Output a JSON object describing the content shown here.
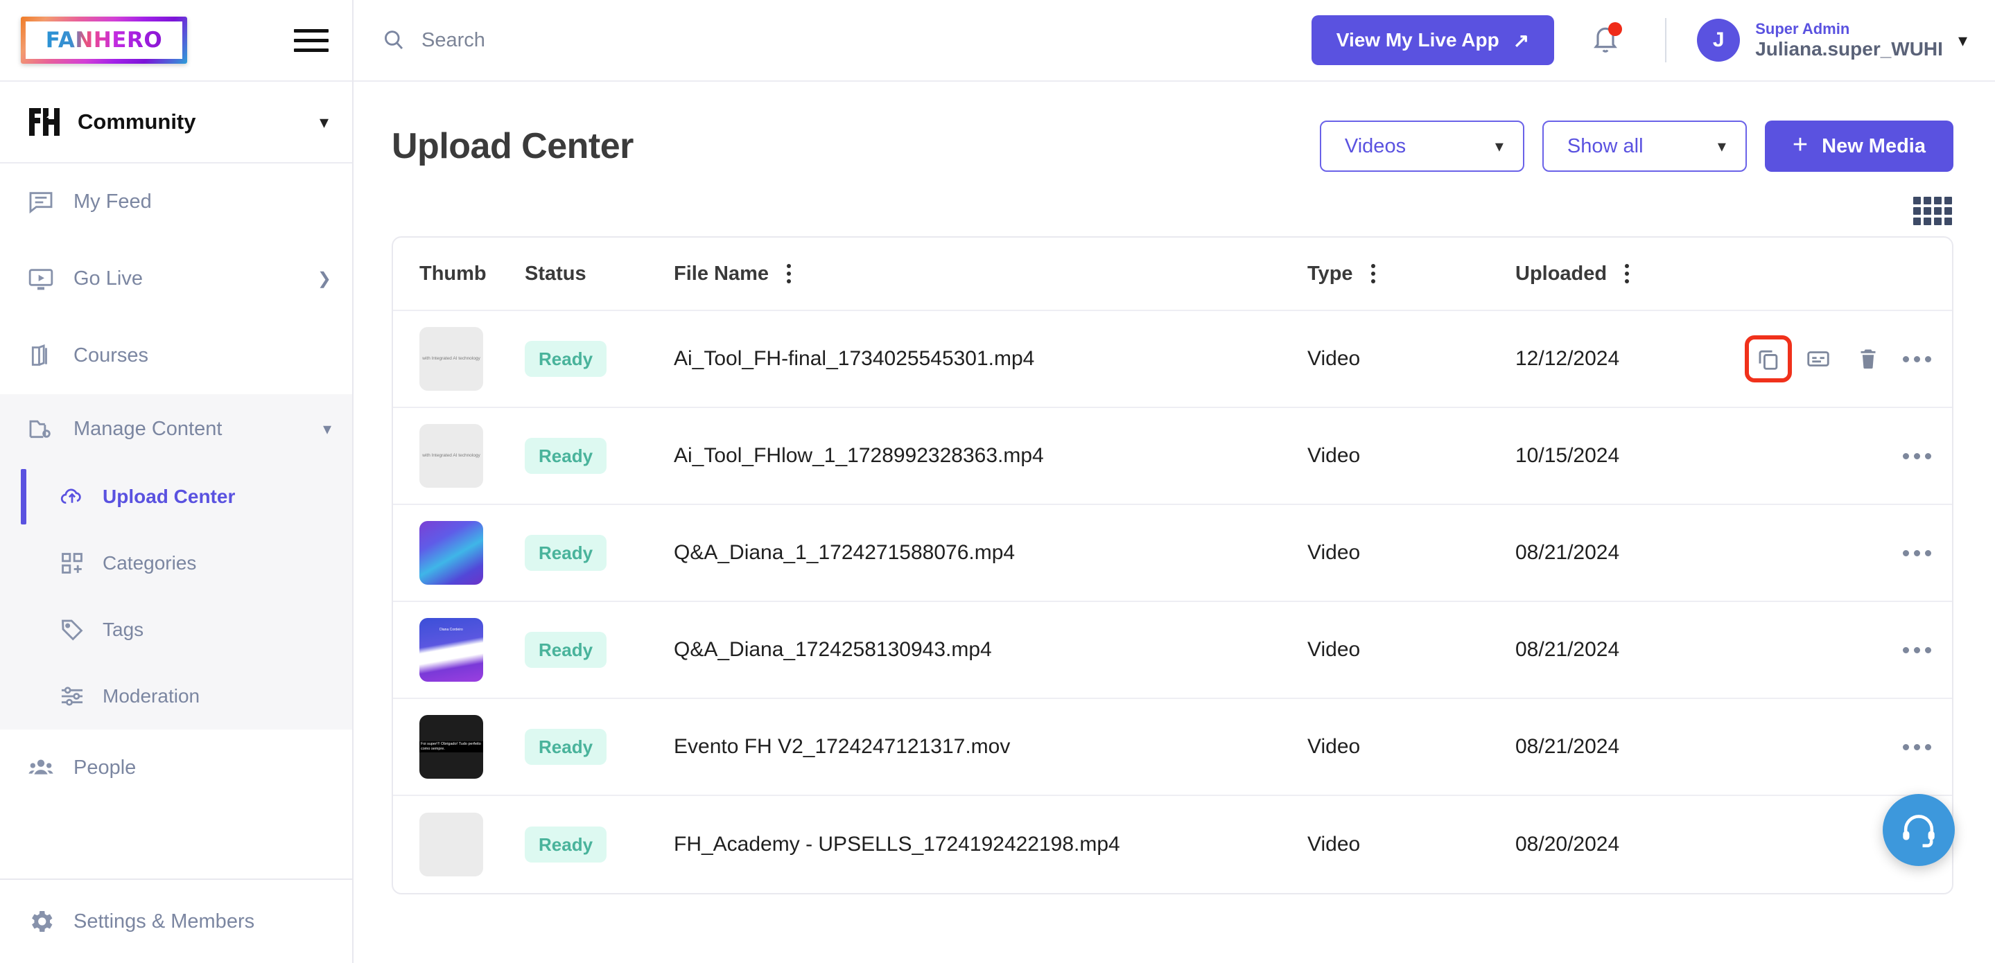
{
  "brand": {
    "logo_text": "FANHERO",
    "accent": "#5a52e0"
  },
  "sidebar": {
    "community": {
      "label": "Community"
    },
    "items": [
      {
        "label": "My Feed",
        "icon": "feed-icon"
      },
      {
        "label": "Go Live",
        "icon": "live-icon"
      },
      {
        "label": "Courses",
        "icon": "courses-icon"
      }
    ],
    "group": {
      "label": "Manage Content",
      "icon": "folder-settings-icon",
      "children": [
        {
          "label": "Upload Center",
          "icon": "cloud-upload-icon",
          "active": true
        },
        {
          "label": "Categories",
          "icon": "categories-icon",
          "active": false
        },
        {
          "label": "Tags",
          "icon": "tag-icon",
          "active": false
        },
        {
          "label": "Moderation",
          "icon": "sliders-icon",
          "active": false
        }
      ]
    },
    "people": {
      "label": "People",
      "icon": "people-icon"
    },
    "settings": {
      "label": "Settings & Members",
      "icon": "gear-icon"
    }
  },
  "topbar": {
    "search_placeholder": "Search",
    "search_value": "",
    "live_app_button": "View My Live App",
    "live_app_arrow": "↗",
    "profile": {
      "role": "Super Admin",
      "name": "Juliana.super_WUHI",
      "initial": "J"
    }
  },
  "page": {
    "title": "Upload Center",
    "type_filter": {
      "value": "Videos"
    },
    "show_filter": {
      "value": "Show all"
    },
    "new_media_button": "New Media"
  },
  "table": {
    "headers": {
      "thumb": "Thumb",
      "status": "Status",
      "file_name": "File Name",
      "type": "Type",
      "uploaded": "Uploaded"
    },
    "rows": [
      {
        "status": "Ready",
        "file_name": "Ai_Tool_FH-final_1734025545301.mp4",
        "type": "Video",
        "uploaded": "12/12/2024",
        "thumb_kind": "doc-light",
        "thumb_text": "with Integrated AI technology",
        "actions": [
          "copy-icon",
          "caption-icon",
          "trash-icon",
          "more-icon"
        ],
        "highlighted_action": "copy-icon"
      },
      {
        "status": "Ready",
        "file_name": "Ai_Tool_FHlow_1_1728992328363.mp4",
        "type": "Video",
        "uploaded": "10/15/2024",
        "thumb_kind": "doc-light",
        "thumb_text": "with Integrated AI technology",
        "actions": [
          "more-icon"
        ],
        "highlighted_action": ""
      },
      {
        "status": "Ready",
        "file_name": "Q&A_Diana_1_1724271588076.mp4",
        "type": "Video",
        "uploaded": "08/21/2024",
        "thumb_kind": "gradient-blue",
        "thumb_text": "",
        "actions": [
          "more-icon"
        ],
        "highlighted_action": ""
      },
      {
        "status": "Ready",
        "file_name": "Q&A_Diana_1724258130943.mp4",
        "type": "Video",
        "uploaded": "08/21/2024",
        "thumb_kind": "gradient-avatar",
        "thumb_text": "Diana Cordeiro",
        "actions": [
          "more-icon"
        ],
        "highlighted_action": ""
      },
      {
        "status": "Ready",
        "file_name": "Evento FH V2_1724247121317.mov",
        "type": "Video",
        "uploaded": "08/21/2024",
        "thumb_kind": "dark-caption",
        "thumb_text": "Foi super!!! Obrigado! Tudo perfeito como sempre.",
        "actions": [
          "more-icon"
        ],
        "highlighted_action": ""
      },
      {
        "status": "Ready",
        "file_name": "FH_Academy - UPSELLS_1724192422198.mp4",
        "type": "Video",
        "uploaded": "08/20/2024",
        "thumb_kind": "doc-blank",
        "thumb_text": "",
        "actions": [
          "more-icon"
        ],
        "highlighted_action": ""
      }
    ]
  },
  "view_toggle": {
    "icon": "grid-view-icon"
  },
  "support": {
    "icon": "headset-icon"
  }
}
